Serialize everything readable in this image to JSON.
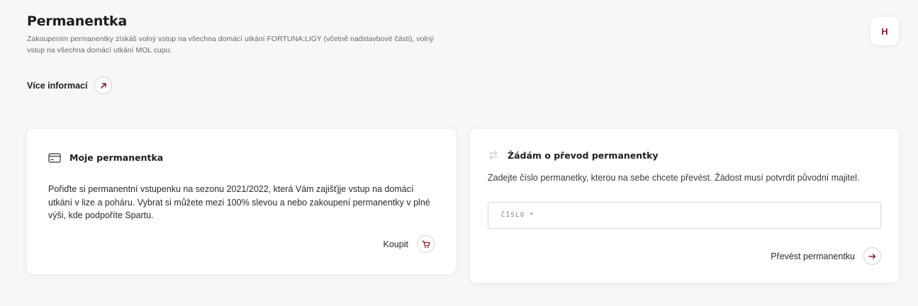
{
  "header": {
    "title": "Permanentka",
    "description": "Zakoupením permanentky získáš volný vstup na všechna domácí utkání FORTUNA:LIGY (včetně nadstavbové části), volný vstup na všechna domácí utkání MOL cupu.",
    "more_info_label": "Více informací",
    "more_info_icon": "arrow-up-right-icon"
  },
  "user": {
    "avatar_initial": "H"
  },
  "my_pass": {
    "icon": "card-icon",
    "title": "Moje permanentka",
    "text": "Pořiďte si permanentní vstupenku na sezonu 2021/2022, která Vám zajišťjje vstup na domácí utkání v lize a poháru. Vybrat si můžete mezi 100% slevou a nebo zakoupení permanentky v plné výši, kde podpoříte Spartu.",
    "buy_label": "Koupit",
    "buy_icon": "cart-icon"
  },
  "transfer": {
    "icon": "swap-arrows-icon",
    "title": "Žádám o převod permanentky",
    "description": "Zadejte číslo permanetky, kterou na sebe chcete převést. Žádost musí potvrdit původní majitel.",
    "field_label": "ČÍSLO *",
    "field_value": "",
    "submit_label": "Převést permanentku",
    "submit_icon": "arrow-right-icon"
  },
  "colors": {
    "accent": "#8d1d2c",
    "background": "#f7f7f7",
    "card": "#ffffff"
  }
}
